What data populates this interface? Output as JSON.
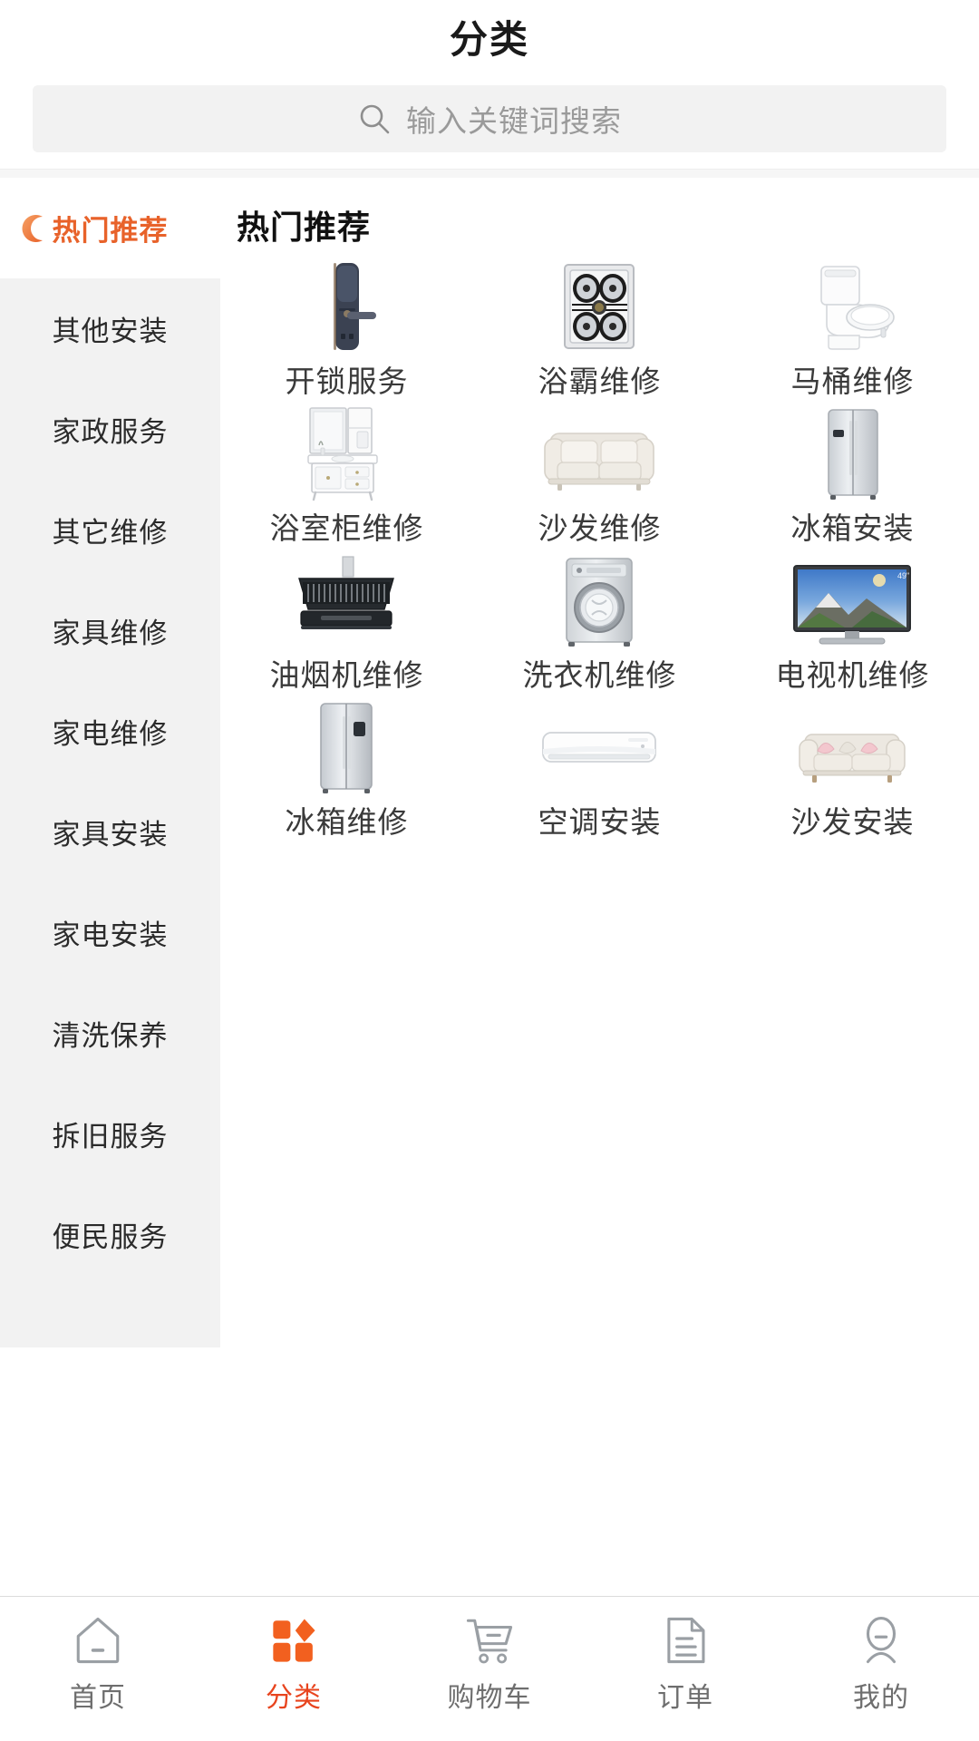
{
  "header": {
    "title": "分类"
  },
  "search": {
    "placeholder": "输入关键词搜索",
    "icon": "search-icon",
    "value": ""
  },
  "sidebar": {
    "active_index": 0,
    "active_color": "#e8622a",
    "items": [
      {
        "label": "热门推荐",
        "icon": "crescent-moon-icon",
        "active": true
      },
      {
        "label": "其他安装",
        "active": false
      },
      {
        "label": "家政服务",
        "active": false
      },
      {
        "label": "其它维修",
        "active": false
      },
      {
        "label": "家具维修",
        "active": false
      },
      {
        "label": "家电维修",
        "active": false
      },
      {
        "label": "家具安装",
        "active": false
      },
      {
        "label": "家电安装",
        "active": false
      },
      {
        "label": "清洗保养",
        "active": false
      },
      {
        "label": "拆旧服务",
        "active": false
      },
      {
        "label": "便民服务",
        "active": false
      }
    ]
  },
  "main": {
    "section_title": "热门推荐",
    "services": [
      {
        "label": "开锁服务",
        "icon": "door-lock-icon"
      },
      {
        "label": "浴霸维修",
        "icon": "bath-heater-icon"
      },
      {
        "label": "马桶维修",
        "icon": "toilet-icon"
      },
      {
        "label": "浴室柜维修",
        "icon": "bathroom-cabinet-icon"
      },
      {
        "label": "沙发维修",
        "icon": "sofa-icon"
      },
      {
        "label": "冰箱安装",
        "icon": "refrigerator-icon"
      },
      {
        "label": "油烟机维修",
        "icon": "range-hood-icon"
      },
      {
        "label": "洗衣机维修",
        "icon": "washing-machine-icon"
      },
      {
        "label": "电视机维修",
        "icon": "television-icon"
      },
      {
        "label": "冰箱维修",
        "icon": "refrigerator-icon"
      },
      {
        "label": "空调安装",
        "icon": "air-conditioner-icon"
      },
      {
        "label": "沙发安装",
        "icon": "sofa-pillow-icon"
      }
    ]
  },
  "tabbar": {
    "active_index": 1,
    "active_color": "#e8441e",
    "inactive_color": "#9a9a9a",
    "items": [
      {
        "label": "首页",
        "icon": "home-icon"
      },
      {
        "label": "分类",
        "icon": "grid-category-icon"
      },
      {
        "label": "购物车",
        "icon": "shopping-cart-icon"
      },
      {
        "label": "订单",
        "icon": "order-document-icon"
      },
      {
        "label": "我的",
        "icon": "user-profile-icon"
      }
    ]
  }
}
